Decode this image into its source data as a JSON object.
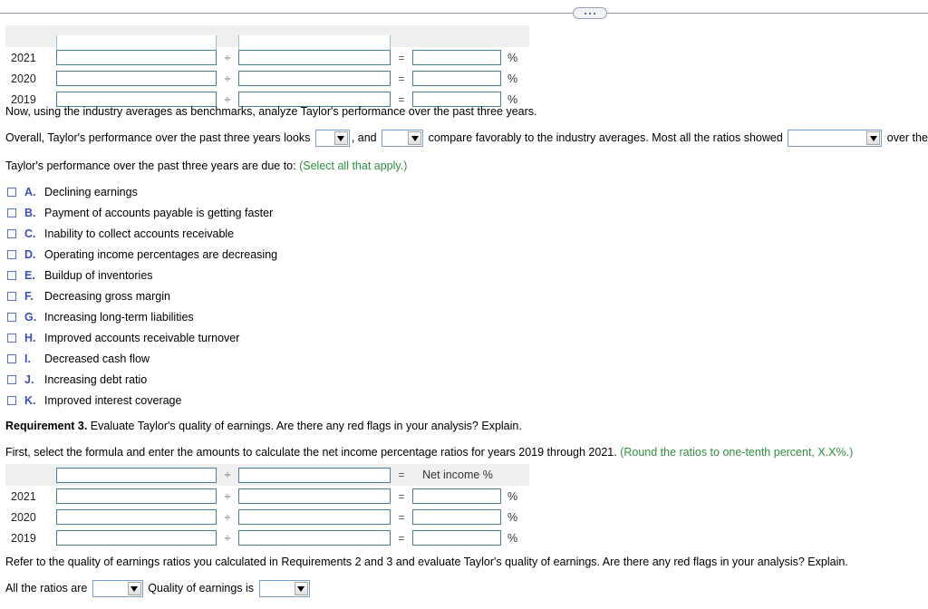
{
  "divider": {
    "handle_label": "···"
  },
  "top_table": {
    "op_divide": "÷",
    "op_equals": "=",
    "percent": "%",
    "rows": [
      {
        "year": "2021"
      },
      {
        "year": "2020"
      },
      {
        "year": "2019"
      }
    ]
  },
  "intro_line": "Now, using the industry averages as benchmarks, analyze Taylor's performance over the past three years.",
  "overall": {
    "seg1": "Overall, Taylor's performance over the past three years looks",
    "seg2": ", and",
    "seg3": "compare favorably to the industry averages. Most all the ratios showed",
    "seg4": "over the three years.",
    "dropdown1_value": "",
    "dropdown2_value": "",
    "dropdown3_value": ""
  },
  "due_to": {
    "text": "Taylor's performance over the past three years are due to:",
    "hint": "(Select all that apply.)"
  },
  "checkboxes": [
    {
      "letter": "A.",
      "label": "Declining earnings"
    },
    {
      "letter": "B.",
      "label": "Payment of accounts payable is getting faster"
    },
    {
      "letter": "C.",
      "label": "Inability to collect accounts receivable"
    },
    {
      "letter": "D.",
      "label": "Operating income percentages are decreasing"
    },
    {
      "letter": "E.",
      "label": "Buildup of inventories"
    },
    {
      "letter": "F.",
      "label": "Decreasing gross margin"
    },
    {
      "letter": "G.",
      "label": "Increasing long-term liabilities"
    },
    {
      "letter": "H.",
      "label": "Improved accounts receivable turnover"
    },
    {
      "letter": "I.",
      "label": "Decreased cash flow"
    },
    {
      "letter": "J.",
      "label": "Increasing debt ratio"
    },
    {
      "letter": "K.",
      "label": "Improved interest coverage"
    }
  ],
  "requirement3": {
    "label": "Requirement 3.",
    "text": "Evaluate Taylor's quality of earnings. Are there any red flags in your analysis? Explain."
  },
  "formula_intro": {
    "text": "First, select the formula and enter the amounts to calculate the net income percentage ratios for years 2019 through 2021.",
    "hint": "(Round the ratios to one-tenth percent, X.X%.)"
  },
  "bottom_table": {
    "header_result": "Net income %",
    "op_divide": "÷",
    "op_equals": "=",
    "percent": "%",
    "numerator_value": "",
    "denominator_value": "",
    "rows": [
      {
        "year": "2021"
      },
      {
        "year": "2020"
      },
      {
        "year": "2019"
      }
    ]
  },
  "refer_line": "Refer to the quality of earnings ratios you calculated in Requirements 2 and 3 and evaluate Taylor's quality of earnings. Are there any red flags in your analysis? Explain.",
  "final_row": {
    "seg1": "All the ratios are",
    "seg2": "Quality of earnings is",
    "dropdown1_value": "",
    "dropdown2_value": ""
  },
  "colors": {
    "hint_green": "#2f8f3e",
    "letter_blue": "#3a4fb8",
    "field_border": "#4a7f96",
    "header_gray": "#efefef"
  }
}
